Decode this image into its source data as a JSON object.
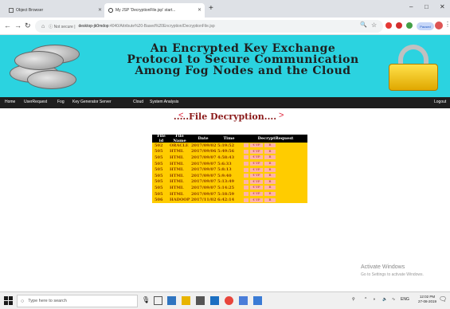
{
  "browser": {
    "tabs": [
      {
        "title": "Object Browser",
        "active": false
      },
      {
        "title": "My JSP 'DecryptionFile.jsp' start...",
        "active": true
      }
    ],
    "new_tab_label": "+",
    "window_controls": [
      "–",
      "□",
      "✕"
    ],
    "url_secure_label": "ⓘ Not secure |",
    "url_host": "desktop-jk0mdop",
    "url_path": ":4040/Attribute%20-Based%20Encryption/DecryptionFile.jsp",
    "paused_label": "Paused"
  },
  "banner": {
    "title_line1": "An Encrypted Key Exchange",
    "title_line2": "Protocol to Secure Communication",
    "title_line3": "Among Fog Nodes and the Cloud"
  },
  "nav": {
    "items": [
      "Home",
      "UserRequest",
      "Fog",
      "Key Generator Server",
      "Cloud",
      "System Analysis"
    ],
    "logout": "Logout"
  },
  "page": {
    "heading": ".....File Decryption....",
    "prev": "<",
    "next": ">"
  },
  "table": {
    "headers": [
      "File id",
      "File Name",
      "Date",
      "Time",
      "DecryptRequest"
    ],
    "rows": [
      {
        "id": "502",
        "name": "ORACLE",
        "date": "2017/09/02",
        "time": "5:19:52"
      },
      {
        "id": "505",
        "name": "HTML",
        "date": "2017/09/06",
        "time": "5:49:56"
      },
      {
        "id": "505",
        "name": "HTML",
        "date": "2017/09/07",
        "time": "4:58:43"
      },
      {
        "id": "505",
        "name": "HTML",
        "date": "2017/09/07",
        "time": "5:6:33"
      },
      {
        "id": "505",
        "name": "HTML",
        "date": "2017/09/07",
        "time": "5:8:13"
      },
      {
        "id": "505",
        "name": "HTML",
        "date": "2017/09/07",
        "time": "5:9:40"
      },
      {
        "id": "505",
        "name": "HTML",
        "date": "2017/09/07",
        "time": "5:13:49"
      },
      {
        "id": "505",
        "name": "HTML",
        "date": "2017/09/07",
        "time": "5:14:25"
      },
      {
        "id": "505",
        "name": "HTML",
        "date": "2017/09/07",
        "time": "5:18:59"
      },
      {
        "id": "506",
        "name": "HADOOP",
        "date": "2017/11/02",
        "time": "6:42:14"
      }
    ],
    "request_buttons": [
      "",
      "€ VP",
      "R"
    ]
  },
  "watermark": {
    "line1": "Activate Windows",
    "line2": "Go to Settings to activate Windows."
  },
  "taskbar": {
    "search_placeholder": "Type here to search",
    "time": "12:02 PM",
    "date": "27-08-2019",
    "lang": "ENG"
  },
  "colors": {
    "banner_bg": "#2bd3e0",
    "nav_bg": "#1e1e1e",
    "table_row_bg": "#ffcc00",
    "heading_color": "#8b1a1a"
  }
}
